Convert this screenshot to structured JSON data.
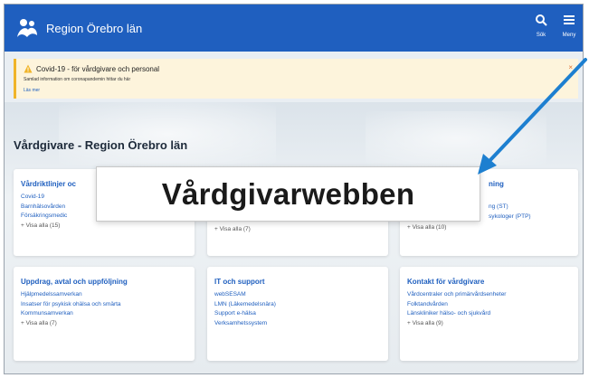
{
  "header": {
    "brand": "Region Örebro län",
    "search_label": "Sök",
    "menu_label": "Meny"
  },
  "alert": {
    "title": "Covid-19 - för vårdgivare och personal",
    "description": "Samlad information om coronapandemin hittar du här",
    "link": "Läs mer",
    "close": "×"
  },
  "page": {
    "title": "Vårdgivare - Region Örebro län"
  },
  "cards": [
    {
      "title": "Vårdriktlinjer oc",
      "items": [
        "Covid-19",
        "Barnhälsovården",
        "Försäkringsmedic"
      ],
      "more": "+ Visa alla (15)"
    },
    {
      "title": "",
      "items": [],
      "more": "+ Visa alla (7)"
    },
    {
      "title": "ning",
      "items": [
        "ng (ST)",
        "sykologer (PTP)"
      ],
      "more": "+ Visa alla (10)"
    },
    {
      "title": "Uppdrag, avtal och uppföljning",
      "items": [
        "Hjälpmedelssamverkan",
        "Insatser för psykisk ohälsa och smärta",
        "Kommunsamverkan"
      ],
      "more": "+ Visa alla (7)"
    },
    {
      "title": "IT och support",
      "items": [
        "webSESAM",
        "LMN (Läkemedelsnära)",
        "Support e-hälsa",
        "Verksamhetssystem"
      ],
      "more": ""
    },
    {
      "title": "Kontakt för vårdgivare",
      "items": [
        "Vårdcentraler och primärvårdsenheter",
        "Folktandvården",
        "Länskliniker hälso- och sjukvård"
      ],
      "more": "+ Visa alla (9)"
    }
  ],
  "overlay": {
    "label": "Vårdgivarwebben"
  },
  "colors": {
    "brand": "#1f5fbf",
    "alert_bg": "#fdf4dc",
    "alert_accent": "#f0b429",
    "arrow": "#1d7fd0"
  }
}
